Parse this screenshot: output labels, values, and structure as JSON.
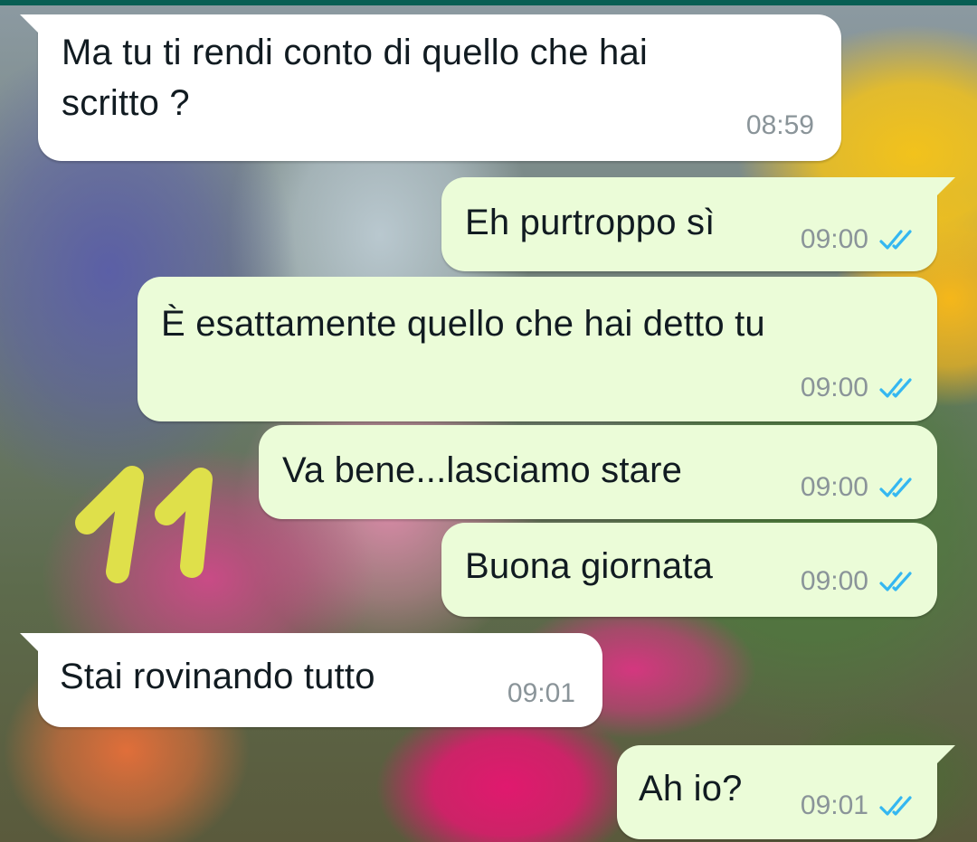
{
  "conversation": {
    "messages": [
      {
        "direction": "incoming",
        "text": "Ma tu ti rendi conto di quello che hai\nscritto ?",
        "time": "08:59"
      },
      {
        "direction": "outgoing",
        "text": "Eh purtroppo sì",
        "time": "09:00",
        "status_icon": "double-check-read-icon"
      },
      {
        "direction": "outgoing",
        "text": "È esattamente quello che hai detto tu",
        "time": "09:00",
        "status_icon": "double-check-read-icon"
      },
      {
        "direction": "outgoing",
        "text": "Va bene...lasciamo stare",
        "time": "09:00",
        "status_icon": "double-check-read-icon"
      },
      {
        "direction": "outgoing",
        "text": "Buona giornata",
        "time": "09:00",
        "status_icon": "double-check-read-icon"
      },
      {
        "direction": "incoming",
        "text": "Stai rovinando tutto",
        "time": "09:01"
      },
      {
        "direction": "outgoing",
        "text": "Ah io?",
        "time": "09:01",
        "status_icon": "double-check-read-icon"
      }
    ]
  },
  "annotation": {
    "text": "11",
    "color": "#dfe04a"
  },
  "colors": {
    "incoming_bubble": "#ffffff",
    "outgoing_bubble": "#ebfcd8",
    "read_ticks": "#34b7f1",
    "timestamp": "#8a9499",
    "header_accent": "#075e54"
  }
}
